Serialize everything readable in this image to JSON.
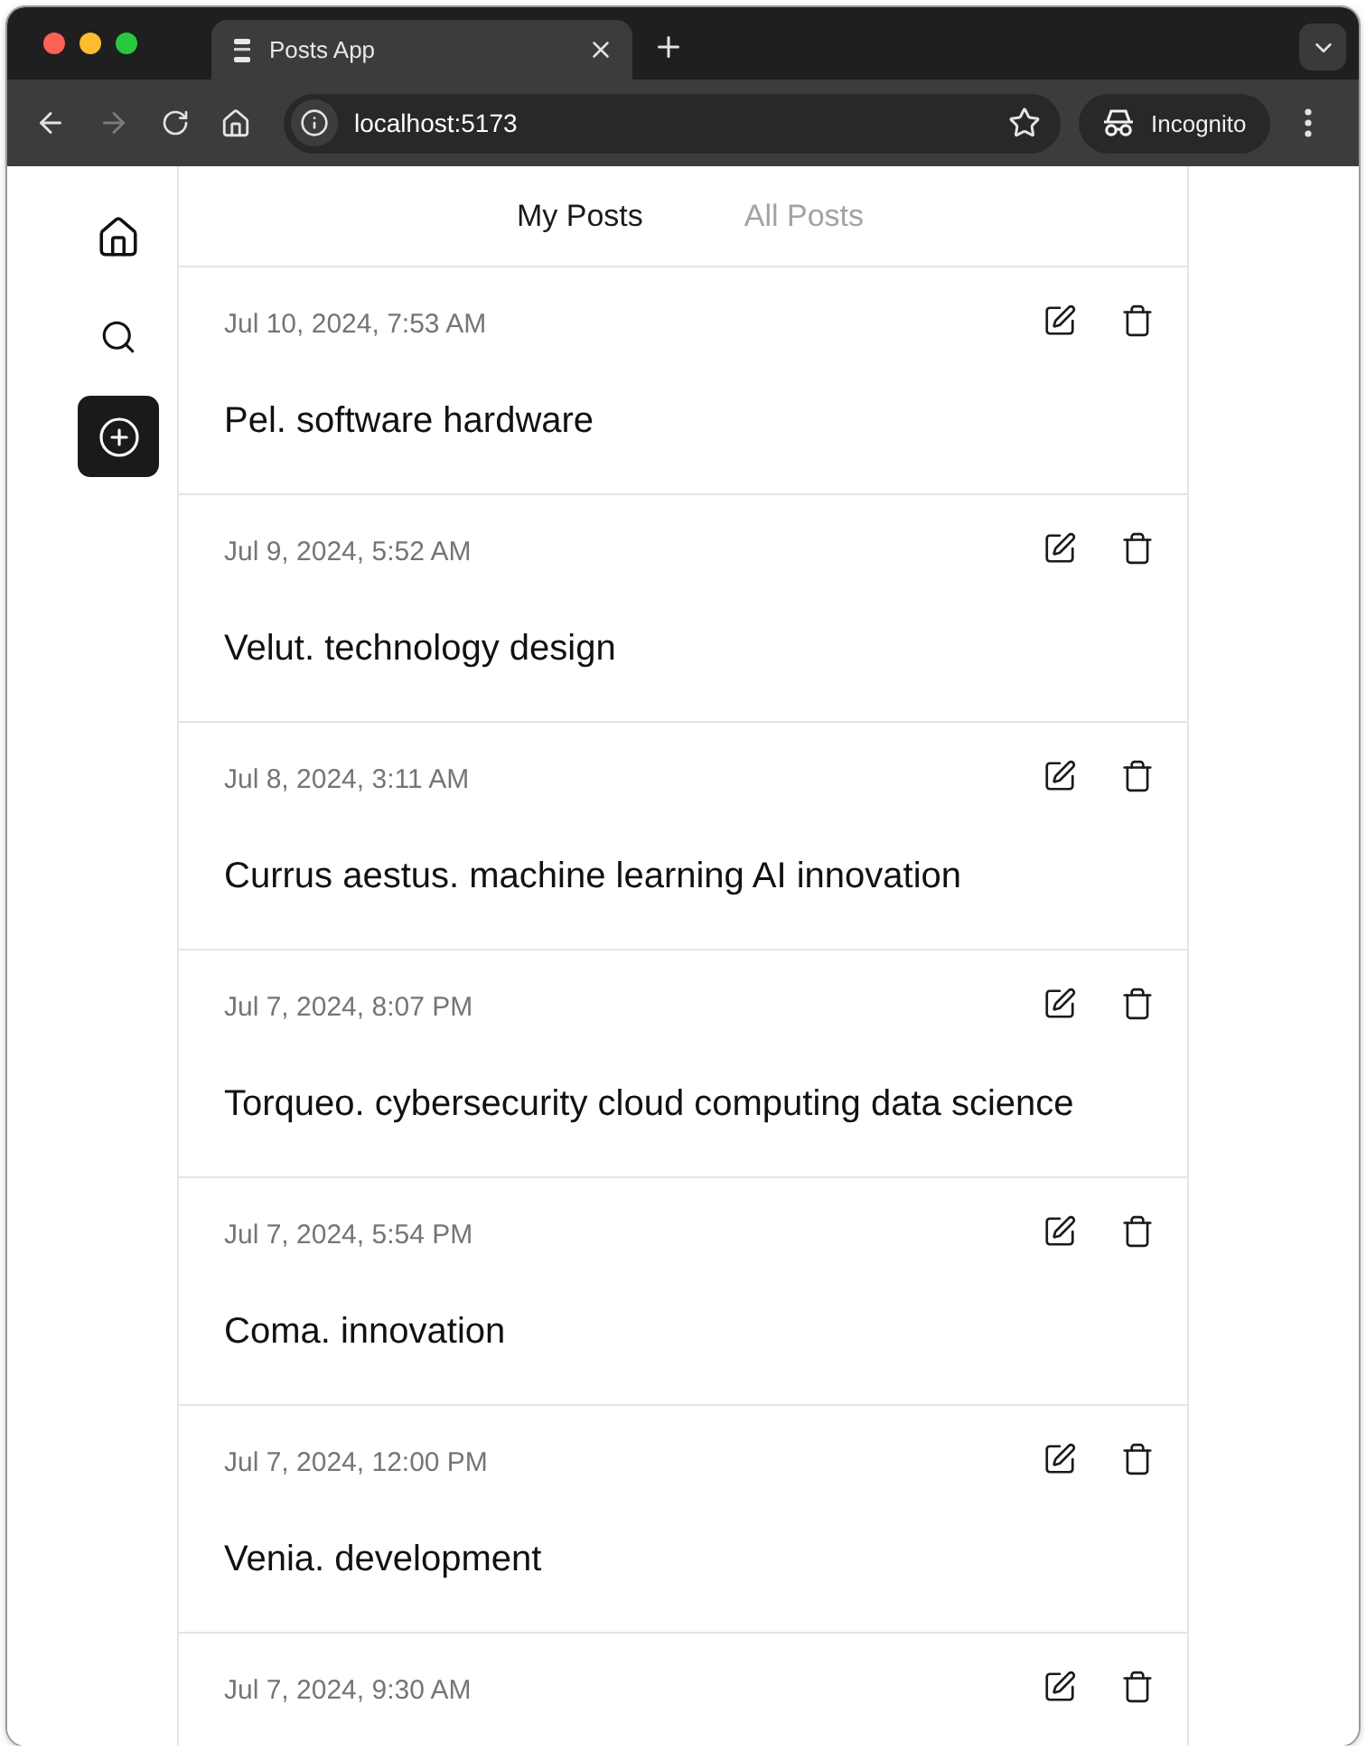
{
  "browser": {
    "tab": {
      "title": "Posts App"
    },
    "nav_buttons": [
      {
        "kind": "back",
        "disabled": false
      },
      {
        "kind": "forward",
        "disabled": true
      },
      {
        "kind": "reload",
        "disabled": false
      },
      {
        "kind": "home",
        "disabled": false
      }
    ],
    "address": "localhost:5173",
    "profile": "Incognito"
  },
  "sidebar": {
    "items": [
      {
        "kind": "home",
        "selected": false
      },
      {
        "kind": "search",
        "selected": false
      },
      {
        "kind": "create",
        "selected": true
      }
    ]
  },
  "tabs": [
    {
      "label": "My Posts",
      "selected": true
    },
    {
      "label": "All Posts",
      "selected": false
    }
  ],
  "posts": [
    {
      "date": "Jul 10, 2024, 7:53 AM",
      "title": "Pel. software hardware"
    },
    {
      "date": "Jul 9, 2024, 5:52 AM",
      "title": "Velut. technology design"
    },
    {
      "date": "Jul 8, 2024, 3:11 AM",
      "title": "Currus aestus. machine learning AI innovation"
    },
    {
      "date": "Jul 7, 2024, 8:07 PM",
      "title": "Torqueo. cybersecurity cloud computing data science"
    },
    {
      "date": "Jul 7, 2024, 5:54 PM",
      "title": "Coma. innovation"
    },
    {
      "date": "Jul 7, 2024, 12:00 PM",
      "title": "Venia. development"
    },
    {
      "date": "Jul 7, 2024, 9:30 AM"
    }
  ]
}
